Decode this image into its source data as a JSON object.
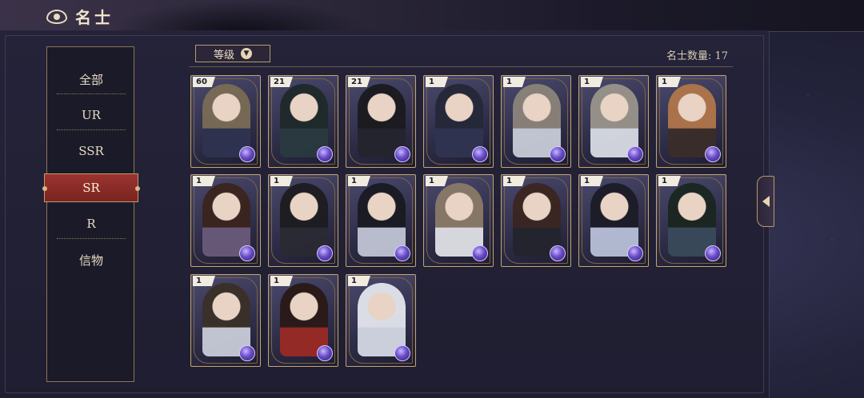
{
  "header": {
    "title": "名士",
    "icon": "mask-icon"
  },
  "menu": {
    "items": [
      {
        "label": "全部",
        "active": false
      },
      {
        "label": "UR",
        "active": false
      },
      {
        "label": "SSR",
        "active": false
      },
      {
        "label": "SR",
        "active": true
      },
      {
        "label": "R",
        "active": false
      },
      {
        "label": "信物",
        "active": false
      }
    ]
  },
  "sort": {
    "label": "等级",
    "icon": "chevron-down-icon"
  },
  "count": {
    "label": "名士数量: 17"
  },
  "cards": [
    {
      "level": "60"
    },
    {
      "level": "21"
    },
    {
      "level": "21"
    },
    {
      "level": "1"
    },
    {
      "level": "1"
    },
    {
      "level": "1"
    },
    {
      "level": "1"
    },
    {
      "level": "1"
    },
    {
      "level": "1"
    },
    {
      "level": "1"
    },
    {
      "level": "1"
    },
    {
      "level": "1"
    },
    {
      "level": "1"
    },
    {
      "level": "1"
    },
    {
      "level": "1"
    },
    {
      "level": "1"
    },
    {
      "level": "1"
    }
  ],
  "colors": {
    "accent_gold": "#c6a46a",
    "active_red": "#8f2d28",
    "panel": "#1f1e31"
  }
}
